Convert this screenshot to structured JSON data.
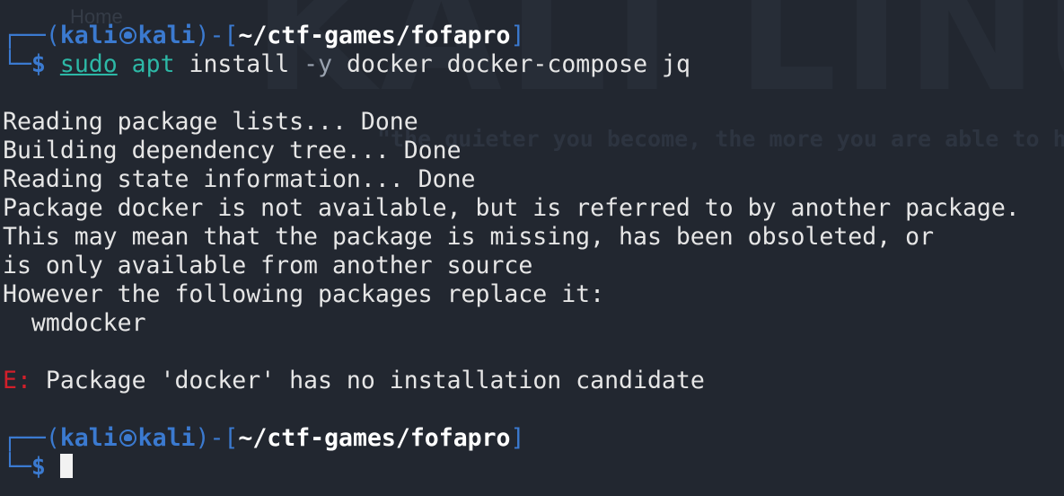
{
  "background": {
    "logo_text": "KALI LINUX",
    "tagline": "\"the quieter you become, the more you are able to hear\"",
    "menu_hint": "Home"
  },
  "colors": {
    "background": "#222730",
    "prompt_blue": "#3b7ad0",
    "command_cyan": "#2db8a6",
    "error_red": "#d21f2a",
    "text": "#e6e6e6"
  },
  "prompt1": {
    "corner_top": "┌──",
    "open": "(",
    "user": "kali",
    "at_icon": "kali-skull-icon",
    "host": "kali",
    "close_sep": ")-[",
    "path": "~/ctf-games/fofapro",
    "close": "]",
    "corner_bottom": "└─",
    "dollar": "$",
    "cmd_sudo": "sudo",
    "cmd_apt": "apt",
    "cmd_install": " install ",
    "cmd_flag": "-y",
    "cmd_args": " docker docker-compose jq"
  },
  "output": {
    "line1": "Reading package lists... Done",
    "line2": "Building dependency tree... Done",
    "line3": "Reading state information... Done",
    "line4": "Package docker is not available, but is referred to by another package.",
    "line5": "This may mean that the package is missing, has been obsoleted, or",
    "line6": "is only available from another source",
    "line7": "However the following packages replace it:",
    "line8": "  wmdocker",
    "error_prefix": "E:",
    "error_text": " Package 'docker' has no installation candidate"
  },
  "prompt2": {
    "corner_top": "┌──",
    "open": "(",
    "user": "kali",
    "at_icon": "kali-skull-icon",
    "host": "kali",
    "close_sep": ")-[",
    "path": "~/ctf-games/fofapro",
    "close": "]",
    "corner_bottom": "└─",
    "dollar": "$"
  }
}
